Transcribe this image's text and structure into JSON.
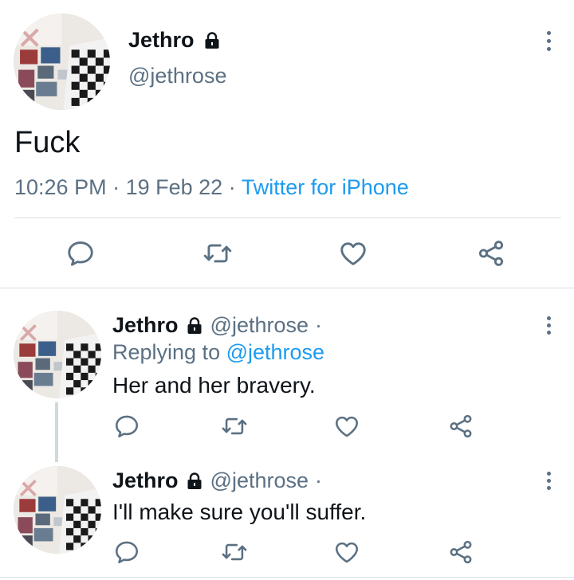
{
  "colors": {
    "text": "#0f1419",
    "muted": "#5b7083",
    "link": "#1d9bf0",
    "divider": "#d8dfe5"
  },
  "main_tweet": {
    "display_name": "Jethro",
    "handle": "@jethrose",
    "text": "Fuck",
    "time": "10:26 PM",
    "sep1": "·",
    "date": "19 Feb 22",
    "sep2": "·",
    "source": "Twitter for iPhone"
  },
  "replies": [
    {
      "display_name": "Jethro",
      "handle": "@jethrose",
      "dot": "·",
      "replying_label": "Replying to",
      "replying_handle": "@jethrose",
      "text": "Her and her bravery."
    },
    {
      "display_name": "Jethro",
      "handle": "@jethrose",
      "dot": "·",
      "text": "I'll make sure you'll suffer."
    }
  ],
  "icons": {
    "reply": "reply-icon",
    "retweet": "retweet-icon",
    "like": "heart-icon",
    "share": "share-icon",
    "more": "more-vertical-icon",
    "lock": "lock-icon"
  }
}
